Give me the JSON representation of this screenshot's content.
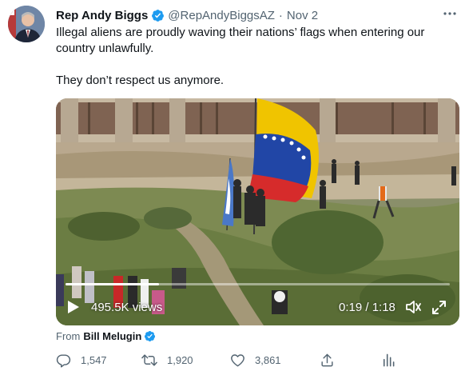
{
  "tweet": {
    "author_name": "Rep Andy Biggs",
    "handle": "@RepAndyBiggsAZ",
    "separator": "·",
    "date": "Nov 2",
    "text_line1": "Illegal aliens are proudly waving their nations’ flags when entering our country unlawfully.",
    "text_line2": "They don’t respect us anymore."
  },
  "video": {
    "views": "495.5K views",
    "time": "0:19 / 1:18",
    "progress": 0.243
  },
  "source": {
    "from_label": "From",
    "name": "Bill Melugin"
  },
  "actions": {
    "replies": "1,547",
    "retweets": "1,920",
    "likes": "3,861"
  },
  "icons": {
    "verified": "verified-badge-icon",
    "more": "more-icon",
    "play": "play-icon",
    "volume": "volume-icon",
    "fullscreen": "fullscreen-icon",
    "reply": "reply-icon",
    "retweet": "retweet-icon",
    "like": "like-icon",
    "share": "share-icon",
    "analytics": "analytics-icon"
  },
  "colors": {
    "accent": "#1d9bf0",
    "text": "#0f1419",
    "secondary": "#536471"
  }
}
